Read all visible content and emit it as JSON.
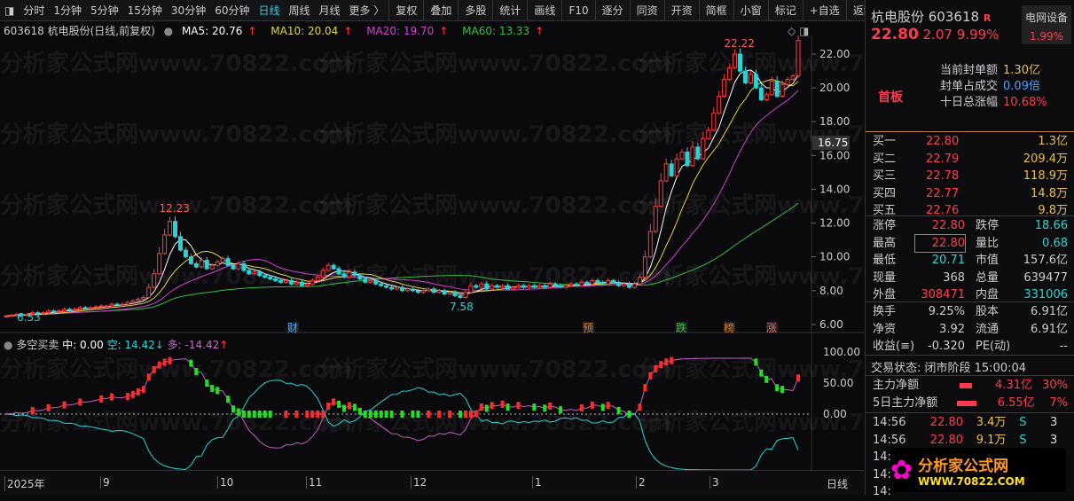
{
  "toolbar": {
    "periods": [
      "分时",
      "1分钟",
      "5分钟",
      "15分钟",
      "30分钟",
      "60分钟",
      "日线",
      "周线",
      "月线",
      "更多 〉"
    ],
    "active": "日线",
    "actions": [
      "复权",
      "叠加",
      "多股",
      "统计",
      "画线",
      "F10",
      "逐分",
      "同资",
      "开资",
      "简框",
      "小窗",
      "标记",
      "+自选",
      "返回"
    ]
  },
  "legend": {
    "title": "603618 杭电股份(日线,前复权)",
    "ma5": "MA5: 20.76",
    "ma10": "MA10: 20.04",
    "ma20": "MA20: 19.70",
    "ma60": "MA60: 13.33",
    "arrow": "↑"
  },
  "colors": {
    "ma5": "#ffffff",
    "ma10": "#e6d23a",
    "ma20": "#d040d0",
    "ma60": "#30c040",
    "up": "#ff3b3b",
    "down": "#27d3d6"
  },
  "watermark": "分析家公式网www.70822.com",
  "indicator": {
    "name": "多空买卖",
    "mid": "中: 0.00",
    "kong": "空: 14.42",
    "kong_arrow": "↓",
    "duo": "多: -14.42",
    "duo_arrow": "↑"
  },
  "crosshair_price": "16.75",
  "chart_data": {
    "type": "candlestick",
    "y_ticks": [
      "22.00",
      "20.00",
      "18.00",
      "16.00",
      "14.00",
      "12.00",
      "10.00",
      "8.00",
      "6.00"
    ],
    "ylim": [
      6,
      22.8
    ],
    "x_ticks": [
      "2025年",
      "9",
      "10",
      "11",
      "12",
      "1",
      "2",
      "3"
    ],
    "period_label": "日线",
    "annotations": [
      "12.23",
      "7.58",
      "22.22",
      "22.80",
      "6.53"
    ],
    "event_marks": [
      "财",
      "预",
      "跌",
      "榜",
      "涨"
    ],
    "indicator_ticks": [
      "100.00",
      "50.00",
      "0.00"
    ],
    "closes": [
      6.5,
      6.55,
      6.6,
      6.55,
      6.6,
      6.7,
      6.65,
      6.7,
      6.8,
      6.75,
      6.8,
      6.9,
      6.85,
      6.9,
      7.0,
      6.95,
      7.0,
      7.05,
      7.1,
      7.1,
      7.2,
      7.15,
      7.2,
      7.3,
      7.4,
      7.5,
      7.6,
      8.2,
      9.0,
      10.2,
      11.3,
      12.1,
      11.2,
      10.4,
      10.0,
      9.6,
      9.4,
      9.8,
      9.3,
      9.5,
      9.7,
      9.9,
      9.5,
      9.3,
      9.6,
      9.2,
      9.0,
      9.1,
      8.9,
      8.8,
      8.7,
      8.6,
      8.5,
      8.6,
      8.4,
      8.5,
      8.3,
      8.4,
      8.6,
      8.8,
      9.2,
      9.5,
      9.3,
      9.0,
      8.8,
      9.1,
      8.9,
      8.7,
      8.5,
      8.6,
      8.4,
      8.3,
      8.2,
      8.1,
      8.2,
      8.0,
      8.1,
      8.0,
      7.9,
      8.0,
      8.1,
      7.9,
      8.0,
      7.8,
      7.9,
      7.7,
      7.6,
      7.9,
      8.3,
      8.2,
      8.4,
      8.1,
      8.3,
      8.2,
      8.3,
      8.1,
      8.2,
      8.3,
      8.2,
      8.3,
      8.2,
      8.3,
      8.2,
      8.4,
      8.3,
      8.2,
      8.3,
      8.4,
      8.3,
      8.5,
      8.4,
      8.6,
      8.5,
      8.4,
      8.6,
      8.5,
      8.3,
      8.4,
      8.2,
      8.4,
      8.8,
      10.0,
      11.5,
      13.0,
      14.5,
      15.5,
      14.8,
      15.8,
      16.2,
      15.4,
      16.5,
      15.8,
      17.0,
      17.5,
      18.5,
      19.5,
      20.5,
      21.2,
      22.0,
      21.0,
      20.3,
      20.8,
      20.0,
      19.3,
      19.6,
      20.4,
      19.5,
      20.2,
      20.5,
      20.7,
      22.8
    ]
  },
  "quote": {
    "name": "杭电股份 603618",
    "r": "R",
    "sector": "电网设备",
    "sector_pct": "1.99%",
    "price": "22.80",
    "change": "2.07",
    "pct": "9.99%",
    "tag": "首板",
    "seal": [
      {
        "k": "当前封单额",
        "v": "1.30亿"
      },
      {
        "k": "封单占成交",
        "v": "0.09倍"
      },
      {
        "k": "十日总涨幅",
        "v": "10.68%"
      }
    ],
    "bids": [
      {
        "k": "买一",
        "p": "22.80",
        "v": "1.3亿"
      },
      {
        "k": "买二",
        "p": "22.79",
        "v": "209.4万"
      },
      {
        "k": "买三",
        "p": "22.78",
        "v": "118.9万"
      },
      {
        "k": "买四",
        "p": "22.77",
        "v": "14.8万"
      },
      {
        "k": "买五",
        "p": "22.76",
        "v": "9.8万"
      }
    ],
    "stats": [
      [
        "涨停",
        "22.80",
        "跌停",
        "18.66"
      ],
      [
        "最高",
        "22.80",
        "量比",
        "0.68"
      ],
      [
        "最低",
        "20.71",
        "市值",
        "157.6亿"
      ],
      [
        "现量",
        "368",
        "总量",
        "639477"
      ],
      [
        "外盘",
        "308471",
        "内盘",
        "331006"
      ]
    ],
    "stats2": [
      [
        "换手",
        "9.25%",
        "股本",
        "6.91亿"
      ],
      [
        "净资",
        "3.92",
        "流通",
        "6.91亿"
      ],
      [
        "收益(≡)",
        "-0.320",
        "PE(动)",
        "--"
      ]
    ],
    "status": "交易状态: 闭市阶段 15:00:04",
    "flows": [
      {
        "k": "主力净额",
        "v": "4.31亿",
        "p": "30%"
      },
      {
        "k": "5日主力净额",
        "v": "6.55亿",
        "p": "7%"
      }
    ],
    "ticks": [
      {
        "t": "14:56",
        "p": "22.80",
        "v": "3.4万",
        "s": "S",
        "n": "3"
      },
      {
        "t": "14:56",
        "p": "22.80",
        "v": "9.1万",
        "s": "S",
        "n": "3"
      },
      {
        "t": "14:",
        "p": "",
        "v": "",
        "s": "",
        "n": ""
      },
      {
        "t": "14:",
        "p": "",
        "v": "",
        "s": "",
        "n": ""
      },
      {
        "t": "14:",
        "p": "",
        "v": "",
        "s": "",
        "n": ""
      }
    ],
    "logo_text": "分析家公式网",
    "logo_url": "WWW.70822.COM"
  }
}
